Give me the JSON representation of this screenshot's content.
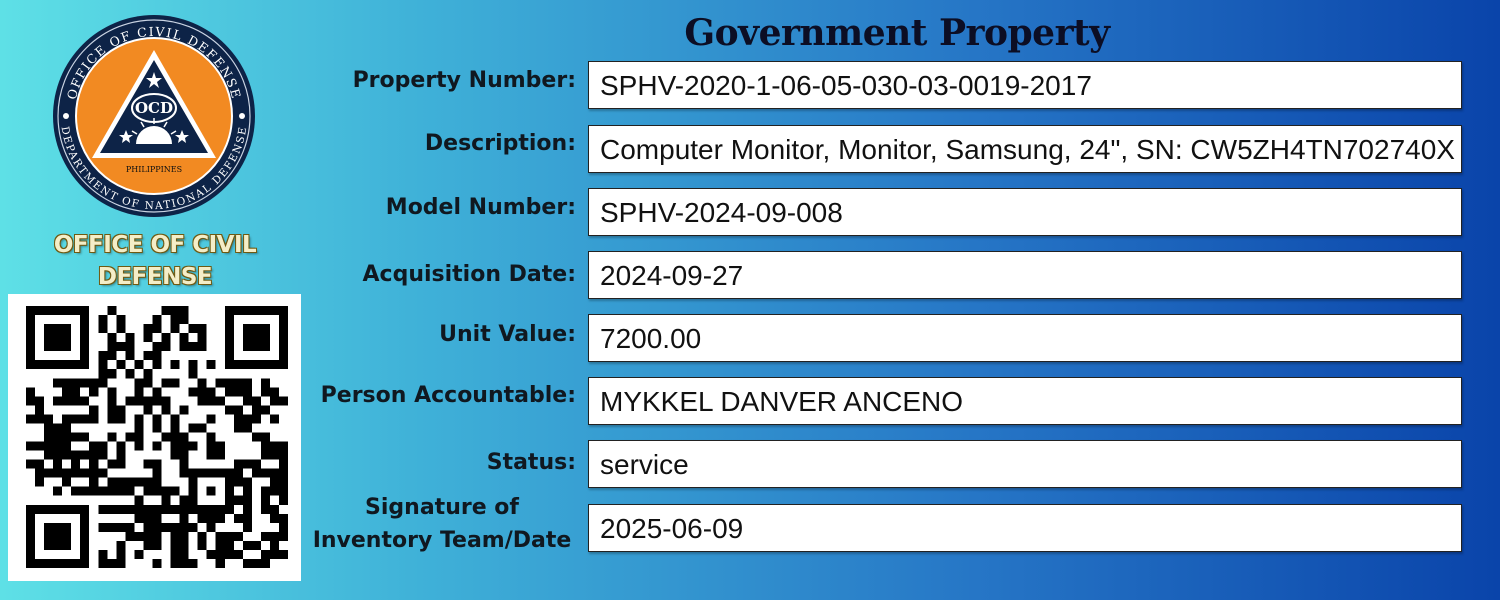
{
  "header": {
    "title": "Government Property"
  },
  "logo": {
    "seal_outer_text_top": "OFFICE OF CIVIL DEFENSE",
    "seal_outer_text_bottom": "DEPARTMENT OF NATIONAL DEFENSE",
    "seal_center_text": "OCD",
    "seal_country": "PHILIPPINES",
    "org_name_line1": "OFFICE OF CIVIL",
    "org_name_line2": "DEFENSE",
    "colors": {
      "seal_ring": "#0d2347",
      "seal_inner": "#f28a22",
      "name_fill": "#f4eec8",
      "name_outline": "#6e5a12"
    }
  },
  "qr": {
    "icon": "qr-code"
  },
  "fields": [
    {
      "label": "Property Number:",
      "value": "SPHV-2020-1-06-05-030-03-0019-2017"
    },
    {
      "label": "Description:",
      "value": "Computer Monitor, Monitor, Samsung, 24\", SN: CW5ZH4TN702740X"
    },
    {
      "label": "Model Number:",
      "value": "SPHV-2024-09-008"
    },
    {
      "label": "Acquisition Date:",
      "value": "2024-09-27"
    },
    {
      "label": "Unit Value:",
      "value": "7200.00"
    },
    {
      "label": "Person Accountable:",
      "value": "MYKKEL DANVER ANCENO"
    },
    {
      "label": "Status:",
      "value": "service"
    },
    {
      "label_line1": "Signature of",
      "label_line2": "Inventory Team/Date",
      "value": "2025-06-09"
    }
  ],
  "colors": {
    "bg_left": "#5ee0e6",
    "bg_right": "#0a44aa",
    "field_bg": "#ffffff"
  }
}
